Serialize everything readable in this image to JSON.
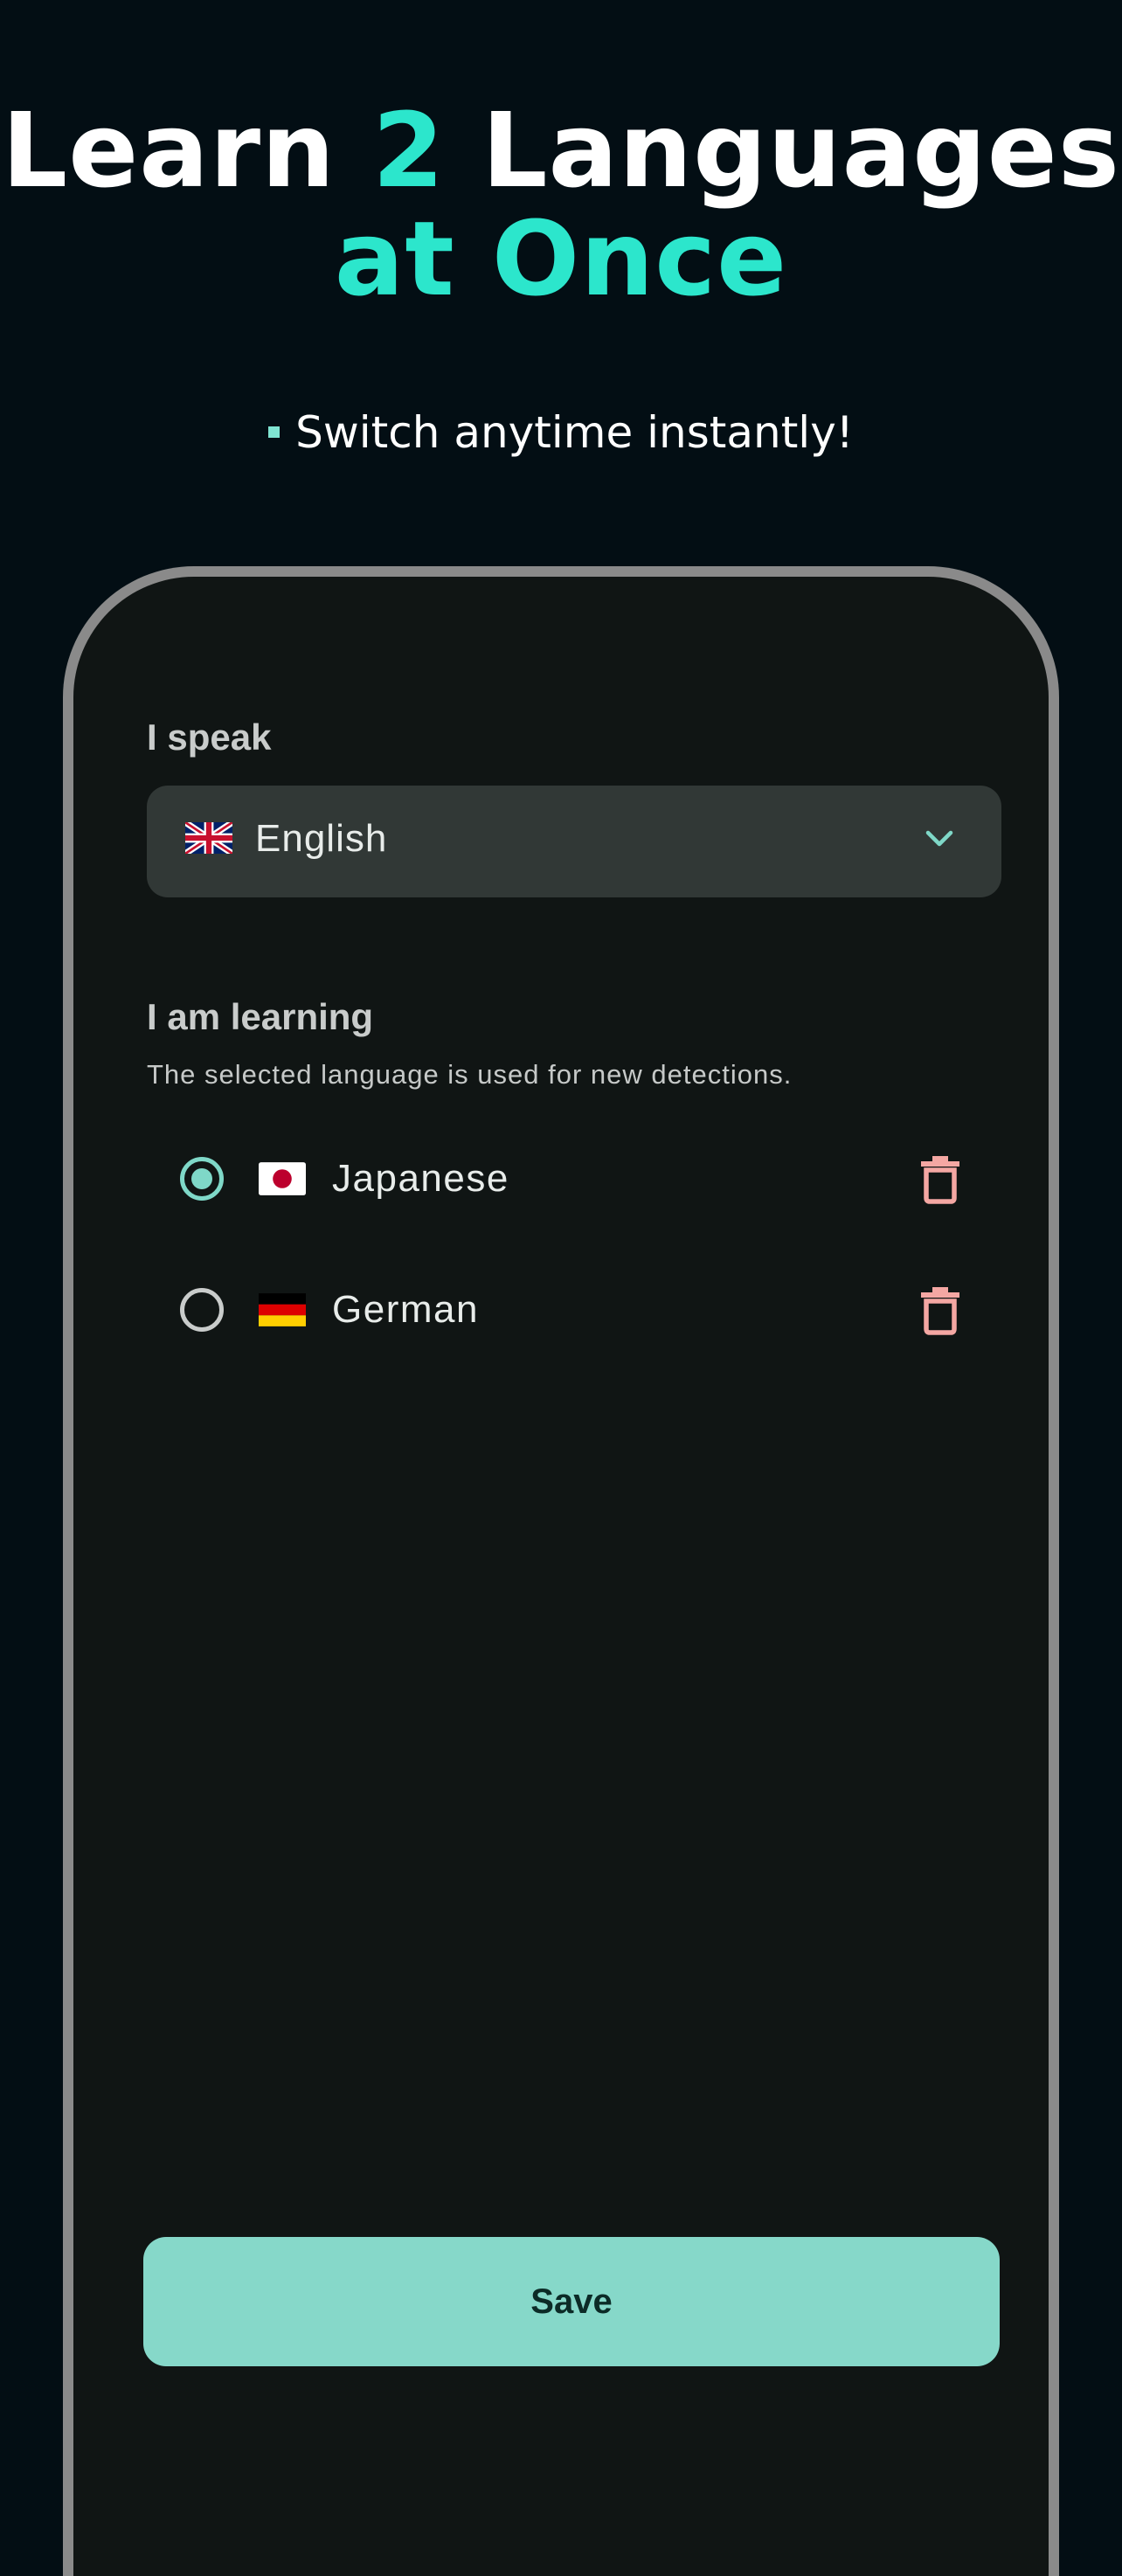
{
  "hero": {
    "line1_part1": "Learn ",
    "line1_accent": "2",
    "line1_part2": " Languages",
    "line2_accent": "at Once"
  },
  "tagline": "Switch anytime instantly!",
  "colors": {
    "background": "#030e14",
    "accent": "#2ce6cc",
    "screen_bg": "#101514",
    "dropdown_bg": "#313836",
    "primary": "#86d8c9",
    "delete": "#f4a7a3",
    "frame": "#8a8a8a"
  },
  "speak": {
    "label": "I speak",
    "selected_value": "English",
    "selected_flag": "uk-flag",
    "dropdown_icon": "chevron-down-icon"
  },
  "learning": {
    "label": "I am learning",
    "helper": "The selected language is used for new detections.",
    "languages": [
      {
        "name": "Japanese",
        "flag": "japan-flag",
        "selected": true
      },
      {
        "name": "German",
        "flag": "germany-flag",
        "selected": false
      }
    ]
  },
  "save_label": "Save"
}
